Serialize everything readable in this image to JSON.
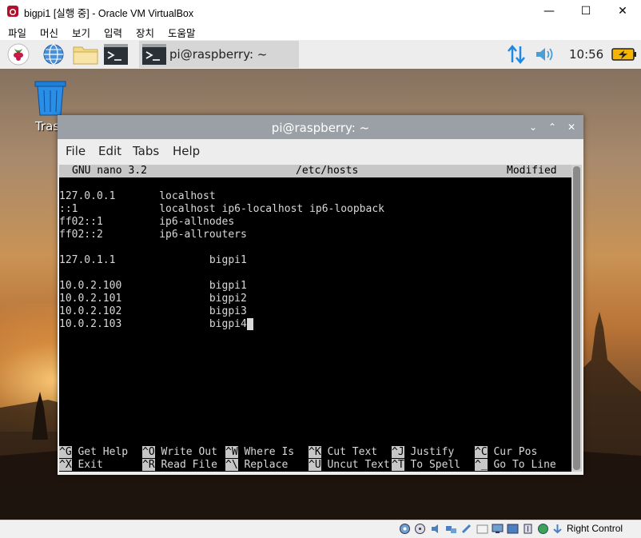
{
  "host": {
    "title": "bigpi1 [실행 중] - Oracle VM VirtualBox",
    "controls": {
      "minimize": "—",
      "maximize": "☐",
      "close": "✕"
    },
    "menu": [
      "파일",
      "머신",
      "보기",
      "입력",
      "장치",
      "도움말"
    ],
    "status_host_key": "Right Control"
  },
  "panel": {
    "task_title": "pi@raspberry: ~",
    "clock": "10:56"
  },
  "desktop": {
    "trash_label": "Tras"
  },
  "terminal": {
    "title": "pi@raspberry: ~",
    "controls": {
      "minimize": "⌄",
      "maximize": "⌃",
      "close": "✕"
    },
    "menu": [
      "File",
      "Edit",
      "Tabs",
      "Help"
    ]
  },
  "nano": {
    "version": "GNU nano 3.2",
    "filename": "/etc/hosts",
    "state": "Modified",
    "lines": [
      "",
      "127.0.0.1       localhost",
      "::1             localhost ip6-localhost ip6-loopback",
      "ff02::1         ip6-allnodes",
      "ff02::2         ip6-allrouters",
      "",
      "127.0.1.1               bigpi1",
      "",
      "10.0.2.100              bigpi1",
      "10.0.2.101              bigpi2",
      "10.0.2.102              bigpi3",
      "10.0.2.103              bigpi4"
    ],
    "shortcuts": [
      [
        {
          "key": "^G",
          "label": "Get Help"
        },
        {
          "key": "^O",
          "label": "Write Out"
        },
        {
          "key": "^W",
          "label": "Where Is"
        },
        {
          "key": "^K",
          "label": "Cut Text"
        },
        {
          "key": "^J",
          "label": "Justify"
        },
        {
          "key": "^C",
          "label": "Cur Pos"
        }
      ],
      [
        {
          "key": "^X",
          "label": "Exit"
        },
        {
          "key": "^R",
          "label": "Read File"
        },
        {
          "key": "^\\",
          "label": "Replace"
        },
        {
          "key": "^U",
          "label": "Uncut Text"
        },
        {
          "key": "^T",
          "label": "To Spell"
        },
        {
          "key": "^_",
          "label": "Go To Line"
        }
      ]
    ]
  },
  "colors": {
    "panel": "#ededed",
    "terminal_title": "#9aa0a6",
    "console_bg": "#000000",
    "console_fg": "#d8d8d8",
    "nano_bar": "#c7c7c7",
    "bluetooth_arrows": "#1e88e5"
  }
}
